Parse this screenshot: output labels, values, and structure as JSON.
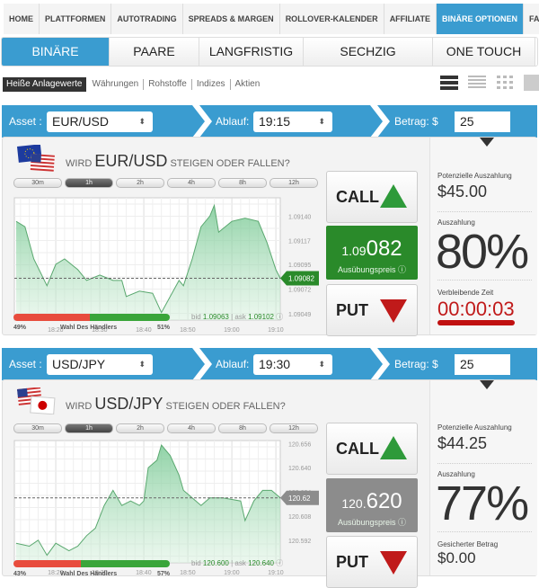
{
  "nav": {
    "items": [
      "HOME",
      "PLATTFORMEN",
      "AUTOTRADING",
      "SPREADS & MARGEN",
      "ROLLOVER-KALENDER",
      "AFFILIATE",
      "BINÄRE OPTIONEN",
      "FAQ"
    ],
    "active": 6
  },
  "subnav": {
    "items": [
      "BINÄRE OPTIONEN",
      "PAARE",
      "LANGFRISTIG",
      "SECHZIG SEKUNDEN",
      "ONE TOUCH"
    ],
    "active": 0
  },
  "filters": {
    "items": [
      "Heiße Anlagewerte",
      "Währungen",
      "Rohstoffe",
      "Indizes",
      "Aktien"
    ],
    "active": 0
  },
  "view_icons": [
    "list-large-icon",
    "list-compact-icon",
    "grid-icon",
    "tile-icon"
  ],
  "colors": {
    "accent": "#3a9cd0",
    "call": "#2e9a3a",
    "put": "#c01a1a",
    "strike_green": "#2a8a2a",
    "strike_gray": "#8c8c8c"
  },
  "timeframes": [
    "30m",
    "1h",
    "2h",
    "4h",
    "8h",
    "12h"
  ],
  "labels": {
    "asset": "Asset :",
    "expiry": "Ablauf:",
    "amount": "Betrag: $",
    "question_pre": "WIRD",
    "question_post": "STEIGEN ODER FALLEN?",
    "call": "CALL",
    "put": "PUT",
    "strike": "Ausübungspreis",
    "potential": "Potenzielle Auszahlung",
    "payout": "Auszahlung",
    "traders": "Wahl Des Händlers",
    "bid": "bid",
    "ask": "ask"
  },
  "x_ticks": [
    "18:20",
    "18:30",
    "18:40",
    "18:50",
    "19:00",
    "19:10"
  ],
  "options": [
    {
      "asset": "EUR/USD",
      "expiry": "19:15",
      "amount": "25",
      "flags": [
        "eu",
        "us"
      ],
      "active_tf": 1,
      "strike_pre": "1.09",
      "strike_post": "082",
      "strike_state": "green",
      "price_tag": "1.09082",
      "y_ticks": [
        "1.09140",
        "1.09117",
        "1.09095",
        "1.09072",
        "1.09049"
      ],
      "ylim": [
        1.09043,
        1.09157
      ],
      "strike_value": 1.09082,
      "bid": "1.09063",
      "ask": "1.09102",
      "sell_pct": "49%",
      "buy_pct": "51%",
      "buy_fraction": 0.51,
      "potential": "$45.00",
      "payout": "80%",
      "third_label": "Verbleibende Zeit",
      "third_value": "00:00:03",
      "series": {
        "t": [
          "18:11",
          "18:13",
          "18:15",
          "18:18",
          "18:20",
          "18:22",
          "18:25",
          "18:27",
          "18:30",
          "18:33",
          "18:35",
          "18:36",
          "18:39",
          "18:42",
          "18:44",
          "18:46",
          "18:48",
          "18:49",
          "18:51",
          "18:53",
          "18:55",
          "18:56",
          "18:57",
          "19:00",
          "19:03",
          "19:06",
          "19:08",
          "19:10",
          "19:11"
        ],
        "v": [
          1.09135,
          1.0913,
          1.091,
          1.09075,
          1.09095,
          1.091,
          1.0909,
          1.0908,
          1.09085,
          1.0908,
          1.0908,
          1.09065,
          1.0907,
          1.09068,
          1.0905,
          1.09065,
          1.0908,
          1.09075,
          1.091,
          1.0913,
          1.0914,
          1.0915,
          1.09125,
          1.09135,
          1.09138,
          1.09135,
          1.09115,
          1.0909,
          1.09082
        ]
      }
    },
    {
      "asset": "USD/JPY",
      "expiry": "19:30",
      "amount": "25",
      "flags": [
        "us",
        "jp"
      ],
      "active_tf": 1,
      "strike_pre": "120.",
      "strike_post": "620",
      "strike_state": "gray",
      "price_tag": "120.62",
      "y_ticks": [
        "120.656",
        "120.640",
        "120.624",
        "120.608",
        "120.592"
      ],
      "ylim": [
        120.577,
        120.658
      ],
      "strike_value": 120.62,
      "bid": "120.600",
      "ask": "120.640",
      "sell_pct": "43%",
      "buy_pct": "57%",
      "buy_fraction": 0.57,
      "potential": "$44.25",
      "payout": "77%",
      "third_label": "Gesicherter Betrag",
      "third_value": "$0.00",
      "series": {
        "t": [
          "18:11",
          "18:14",
          "18:16",
          "18:18",
          "18:20",
          "18:23",
          "18:25",
          "18:27",
          "18:29",
          "18:31",
          "18:33",
          "18:35",
          "18:37",
          "18:39",
          "18:40",
          "18:41",
          "18:43",
          "18:44",
          "18:46",
          "18:48",
          "18:49",
          "18:51",
          "18:53",
          "18:55",
          "18:58",
          "19:02",
          "19:03",
          "19:05",
          "19:07",
          "19:09",
          "19:11"
        ],
        "v": [
          120.59,
          120.588,
          120.592,
          120.582,
          120.59,
          120.585,
          120.588,
          120.595,
          120.6,
          120.615,
          120.625,
          120.615,
          120.618,
          120.615,
          120.618,
          120.64,
          120.645,
          120.655,
          120.648,
          120.635,
          120.625,
          120.62,
          120.615,
          120.62,
          120.62,
          120.618,
          120.605,
          120.618,
          120.625,
          120.625,
          120.62
        ]
      }
    }
  ]
}
